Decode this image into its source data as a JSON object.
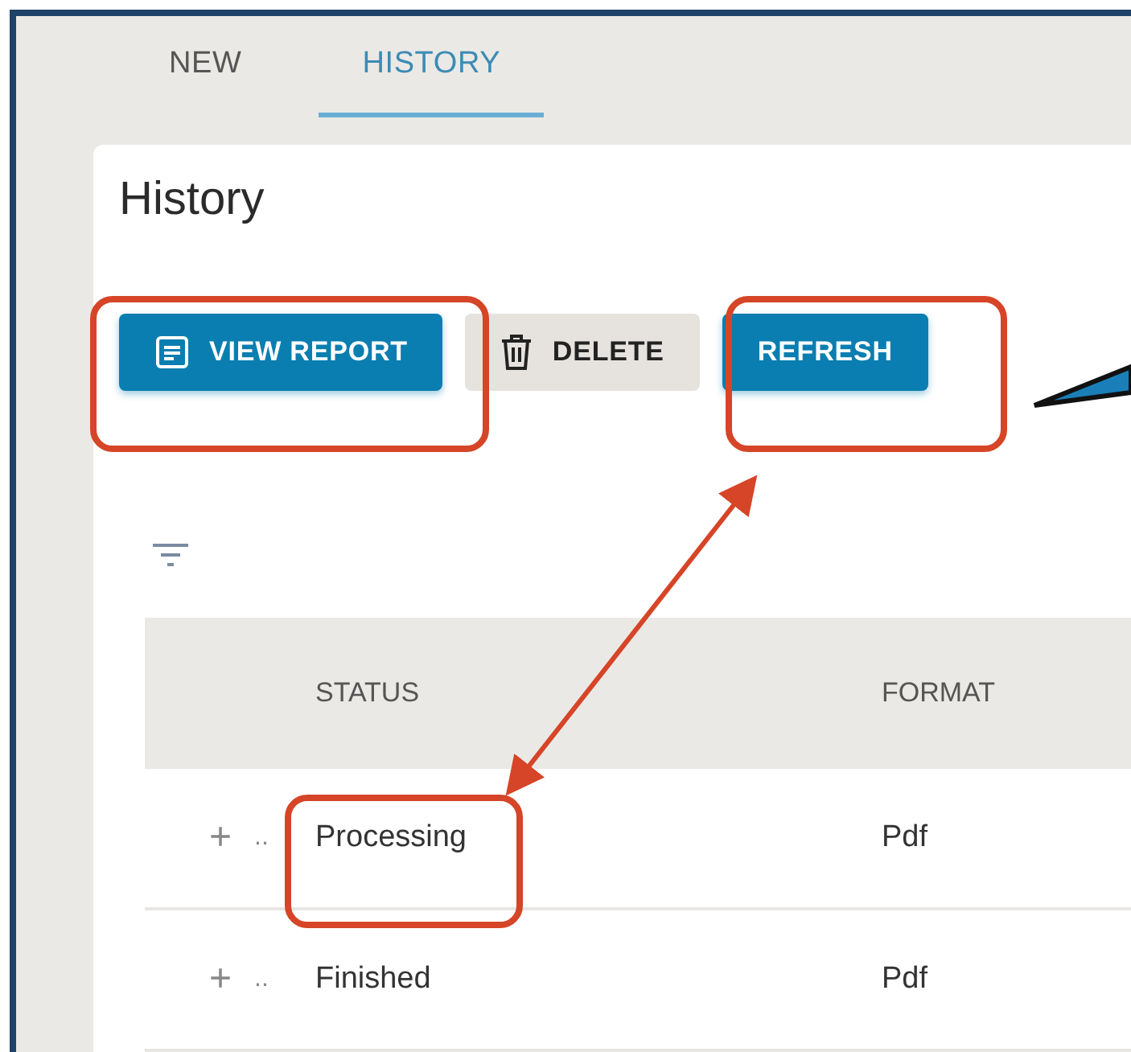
{
  "tabs": [
    {
      "label": "NEW",
      "selected": false
    },
    {
      "label": "HISTORY",
      "selected": true
    }
  ],
  "card": {
    "title": "History",
    "buttons": [
      {
        "label": "VIEW REPORT",
        "kind": "primary"
      },
      {
        "label": "DELETE",
        "kind": "secondary"
      },
      {
        "label": "REFRESH",
        "kind": "primary"
      }
    ]
  },
  "table": {
    "columns": [
      "STATUS",
      "FORMAT"
    ],
    "rows": [
      {
        "expander": "+",
        "ellipsis": "..",
        "status": "Processing",
        "format": "Pdf"
      },
      {
        "expander": "+",
        "ellipsis": "..",
        "status": "Finished",
        "format": "Pdf"
      }
    ]
  }
}
